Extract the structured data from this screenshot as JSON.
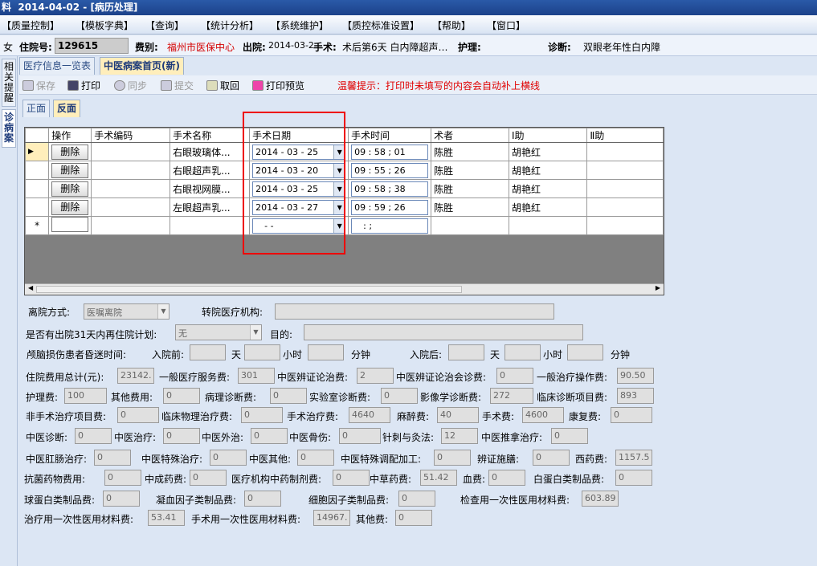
{
  "window": {
    "title": "料  2014-04-02 - [病历处理]"
  },
  "menu": [
    "【质量控制】",
    "【模板字典】",
    "【查询】",
    "【统计分析】",
    "【系统维护】",
    "【质控标准设置】",
    "【帮助】",
    "【窗口】"
  ],
  "patient": {
    "gender": "女",
    "id_label": "住院号:",
    "id_value": "129615",
    "type_label": "费别:",
    "type_value": "福州市医保中心",
    "discharge_label": "出院:",
    "discharge_value": "2014-03-2",
    "surgery_label": "手术:",
    "surgery_value": "术后第6天  白内障超声…",
    "nurse_label": "护理:",
    "diag_label": "诊断:",
    "diag_value": "双眼老年性白内障"
  },
  "side_tabs": [
    "相关提醒",
    "诊病案"
  ],
  "doc_tabs": [
    "医疗信息一览表",
    "中医病案首页(新)"
  ],
  "toolbar": {
    "save": "保存",
    "print": "打印",
    "sync": "同步",
    "submit": "提交",
    "fetch": "取回",
    "preview": "打印预览",
    "tip": "温馨提示：打印时未填写的内容会自动补上横线"
  },
  "page_tabs": [
    "正面",
    "反面"
  ],
  "grid": {
    "headers": [
      "操作",
      "手术编码",
      "手术名称",
      "手术日期",
      "手术时间",
      "术者",
      "Ⅰ助",
      "Ⅱ助"
    ],
    "delete_label": "删除",
    "rows": [
      {
        "name": "右眼玻璃体...",
        "date": "2014 - 03 - 25",
        "time": "09 : 58 ; 01",
        "surgeon": "陈胜",
        "a1": "胡艳红"
      },
      {
        "name": "右眼超声乳...",
        "date": "2014 - 03 - 20",
        "time": "09 : 55 ; 26",
        "surgeon": "陈胜",
        "a1": "胡艳红"
      },
      {
        "name": "右眼视网膜...",
        "date": "2014 - 03 - 25",
        "time": "09 : 58 ; 38",
        "surgeon": "陈胜",
        "a1": "胡艳红"
      },
      {
        "name": "左眼超声乳...",
        "date": "2014 - 03 - 27",
        "time": "09 : 59 ; 26",
        "surgeon": "陈胜",
        "a1": "胡艳红"
      }
    ],
    "new_row": {
      "marker": "*",
      "date": "  -   -",
      "time": " :  ;"
    }
  },
  "form": {
    "discharge_mode_label": "离院方式:",
    "discharge_mode": "医嘱离院",
    "transfer_label": "转院医疗机构:",
    "readmit_label": "是否有出院31天内再住院计划:",
    "readmit": "无",
    "purpose_label": "目的:",
    "coma_label": "颅脑损伤患者昏迷时间:",
    "before_label": "入院前:",
    "after_label": "入院后:",
    "day": "天",
    "hour": "小时",
    "minute": "分钟",
    "fees": [
      {
        "label": "住院费用总计(元):",
        "value": "23142."
      },
      {
        "label": "一般医疗服务费:",
        "value": "301"
      },
      {
        "label": "中医辨证论治费:",
        "value": "2"
      },
      {
        "label": "中医辨证论治会诊费:",
        "value": "0"
      },
      {
        "label": "一般治疗操作费:",
        "value": "90.50"
      },
      {
        "label": "护理费:",
        "value": "100"
      },
      {
        "label": "其他费用:",
        "value": "0"
      },
      {
        "label": "病理诊断费:",
        "value": "0"
      },
      {
        "label": "实验室诊断费:",
        "value": "0"
      },
      {
        "label": "影像学诊断费:",
        "value": "272"
      },
      {
        "label": "临床诊断项目费:",
        "value": "893"
      },
      {
        "label": "非手术治疗项目费:",
        "value": "0"
      },
      {
        "label": "临床物理治疗费:",
        "value": "0"
      },
      {
        "label": "手术治疗费:",
        "value": "4640"
      },
      {
        "label": "麻醉费:",
        "value": "40"
      },
      {
        "label": "手术费:",
        "value": "4600"
      },
      {
        "label": "康复费:",
        "value": "0"
      },
      {
        "label": "中医诊断:",
        "value": "0"
      },
      {
        "label": "中医治疗:",
        "value": "0"
      },
      {
        "label": "中医外治:",
        "value": "0"
      },
      {
        "label": "中医骨伤:",
        "value": "0"
      },
      {
        "label": "针刺与灸法:",
        "value": "12"
      },
      {
        "label": "中医推拿治疗:",
        "value": "0"
      },
      {
        "label": "中医肛肠治疗:",
        "value": "0"
      },
      {
        "label": "中医特殊治疗:",
        "value": "0"
      },
      {
        "label": "中医其他:",
        "value": "0"
      },
      {
        "label": "中医特殊调配加工:",
        "value": "0"
      },
      {
        "label": "辨证施膳:",
        "value": "0"
      },
      {
        "label": "西药费:",
        "value": "1157.5"
      },
      {
        "label": "抗菌药物费用:",
        "value": "0"
      },
      {
        "label": "中成药费:",
        "value": "0"
      },
      {
        "label": "医疗机构中药制剂费:",
        "value": "0"
      },
      {
        "label": "中草药费:",
        "value": "51.42"
      },
      {
        "label": "血费:",
        "value": "0"
      },
      {
        "label": "白蛋白类制品费:",
        "value": "0"
      },
      {
        "label": "球蛋白类制品费:",
        "value": "0"
      },
      {
        "label": "凝血因子类制品费:",
        "value": "0"
      },
      {
        "label": "细胞因子类制品费:",
        "value": "0"
      },
      {
        "label": "检查用一次性医用材料费:",
        "value": "603.89"
      },
      {
        "label": "治疗用一次性医用材料费:",
        "value": "53.41"
      },
      {
        "label": "手术用一次性医用材料费:",
        "value": "14967."
      },
      {
        "label": "其他费:",
        "value": "0"
      }
    ]
  }
}
